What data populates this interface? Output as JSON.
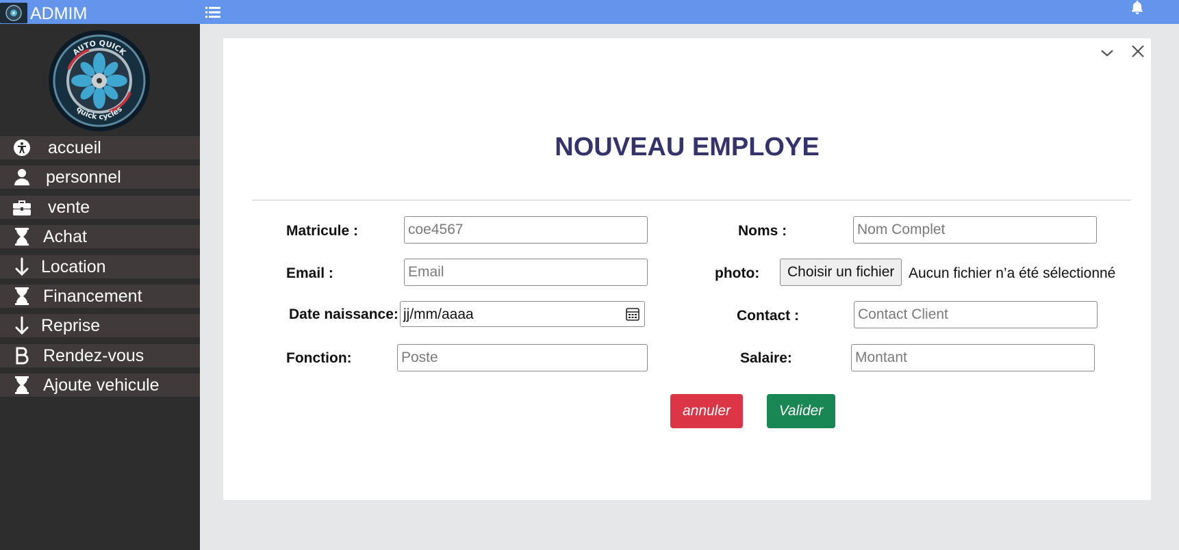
{
  "app": {
    "brand": "ADMIM",
    "logo_text_top": "AUTO QUICK",
    "logo_text_bottom": "quick cycles"
  },
  "sidebar": {
    "items": [
      {
        "label": "accueil",
        "icon": "accessibility-icon"
      },
      {
        "label": "personnel",
        "icon": "user-icon"
      },
      {
        "label": "vente",
        "icon": "briefcase-icon"
      },
      {
        "label": "Achat",
        "icon": "hourglass-icon"
      },
      {
        "label": "Location",
        "icon": "arrow-down-icon"
      },
      {
        "label": "Financement",
        "icon": "hourglass-icon"
      },
      {
        "label": "Reprise",
        "icon": "arrow-down-icon"
      },
      {
        "label": "Rendez-vous",
        "icon": "bitcoin-b-icon"
      },
      {
        "label": "Ajoute vehicule",
        "icon": "hourglass-icon"
      }
    ]
  },
  "form": {
    "title": "NOUVEAU EMPLOYE",
    "matricule_label": "Matricule :",
    "matricule_placeholder": "coe4567",
    "noms_label": "Noms :",
    "noms_placeholder": "Nom Complet",
    "email_label": "Email :",
    "email_placeholder": "Email",
    "photo_label": "photo:",
    "photo_button": "Choisir un fichier",
    "photo_status": "Aucun fichier n’a été sélectionné",
    "date_label": "Date naissance:",
    "date_value": "jj/mm/aaaa",
    "contact_label": "Contact :",
    "contact_placeholder": "Contact Client",
    "fonction_label": "Fonction:",
    "fonction_placeholder": "Poste",
    "salaire_label": "Salaire:",
    "salaire_placeholder": "Montant",
    "cancel_label": "annuler",
    "submit_label": "Valider"
  },
  "colors": {
    "topbar": "#6495ed",
    "sidebar": "#2d2d2d",
    "title": "#34336b",
    "cancel": "#dc3545",
    "submit": "#198754"
  }
}
